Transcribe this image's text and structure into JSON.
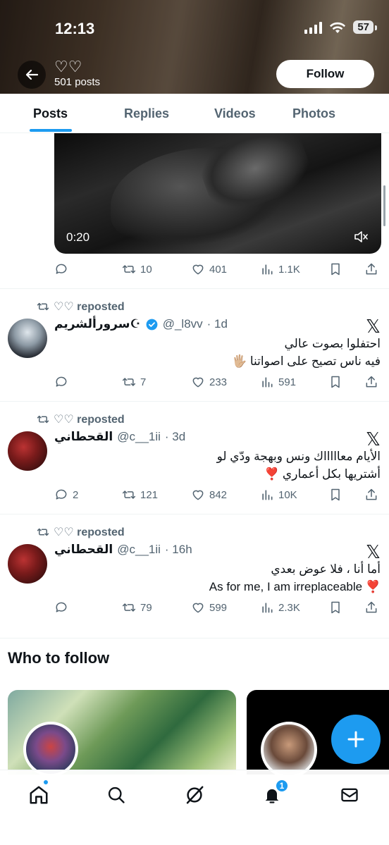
{
  "status_bar": {
    "time": "12:13",
    "battery": "57"
  },
  "header": {
    "name": "♡♡",
    "posts_count": "501 posts",
    "follow_label": "Follow"
  },
  "tabs": [
    {
      "label": "Posts",
      "active": true
    },
    {
      "label": "Replies",
      "active": false
    },
    {
      "label": "Videos",
      "active": false
    },
    {
      "label": "Photos",
      "active": false
    }
  ],
  "video_post": {
    "duration": "0:20",
    "stats": {
      "replies": "",
      "reposts": "10",
      "likes": "401",
      "views": "1.1K"
    }
  },
  "posts": [
    {
      "repost_label": "♡♡ reposted",
      "name": "سرورألشريم☪︎",
      "verified": true,
      "handle": "@_l8vv",
      "time": "· 1d",
      "text_line1": "احتفلوا بصوت عالي",
      "text_line2": "فيه ناس تصيح على اصواتنا 🖐🏼",
      "stats": {
        "replies": "",
        "reposts": "7",
        "likes": "233",
        "views": "591"
      }
    },
    {
      "repost_label": "♡♡ reposted",
      "name": "القحطاني",
      "verified": false,
      "handle": "@c__1ii",
      "time": "· 3d",
      "text_line1": "الأيام معاااااك ونس وبهجة ودّي لو",
      "text_line2": "أشتريها بكل أعماري ❣️",
      "stats": {
        "replies": "2",
        "reposts": "121",
        "likes": "842",
        "views": "10K"
      }
    },
    {
      "repost_label": "♡♡ reposted",
      "name": "القحطاني",
      "verified": false,
      "handle": "@c__1ii",
      "time": "· 16h",
      "text_line1": "أما أنا ، فلا عوض بعدي",
      "text_line2": "As for me, I am irreplaceable ❣️",
      "stats": {
        "replies": "",
        "reposts": "79",
        "likes": "599",
        "views": "2.3K"
      }
    }
  ],
  "who_to_follow": {
    "title": "Who to follow"
  },
  "bottom_nav": {
    "notifications_badge": "1"
  },
  "colors": {
    "accent": "#1d9bf0",
    "text": "#0f1419",
    "secondary": "#536471"
  }
}
